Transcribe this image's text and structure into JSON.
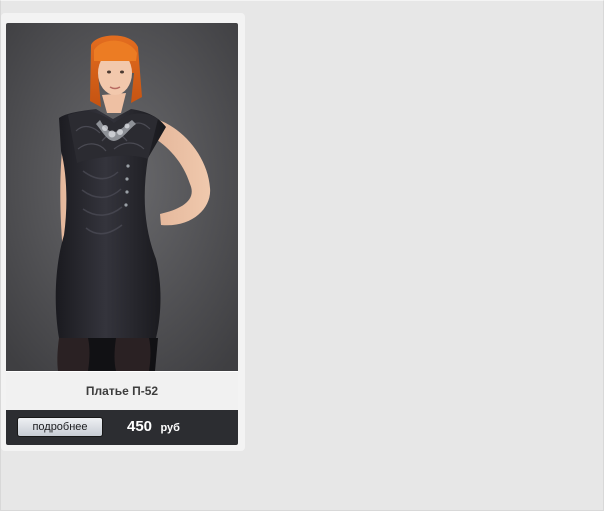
{
  "product": {
    "name": "Платье П-52",
    "details_label": "подробнее",
    "price": "450",
    "currency": "руб"
  },
  "colors": {
    "background": "#e6e6e6",
    "bottom_bar": "#2c2d31",
    "name_bar": "#f1f1f1"
  }
}
